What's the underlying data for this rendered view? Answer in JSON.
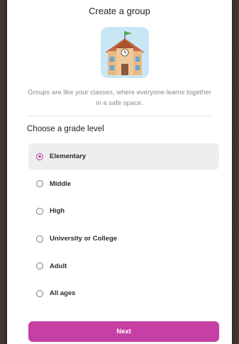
{
  "modal": {
    "title": "Create a group",
    "illustration_icon": "school-building-icon",
    "description": "Groups are like your classes, where everyone learns together in a safe space."
  },
  "grade_section": {
    "heading": "Choose a grade level",
    "options": [
      {
        "label": "Elementary",
        "selected": true
      },
      {
        "label": "Middle",
        "selected": false
      },
      {
        "label": "High",
        "selected": false
      },
      {
        "label": "University or College",
        "selected": false
      },
      {
        "label": "Adult",
        "selected": false
      },
      {
        "label": "All ages",
        "selected": false
      }
    ]
  },
  "actions": {
    "next_label": "Next"
  },
  "colors": {
    "accent": "#c63fa5",
    "selected_bg": "#eeeeef",
    "text": "#1f1f28",
    "muted": "#8a8a94"
  }
}
